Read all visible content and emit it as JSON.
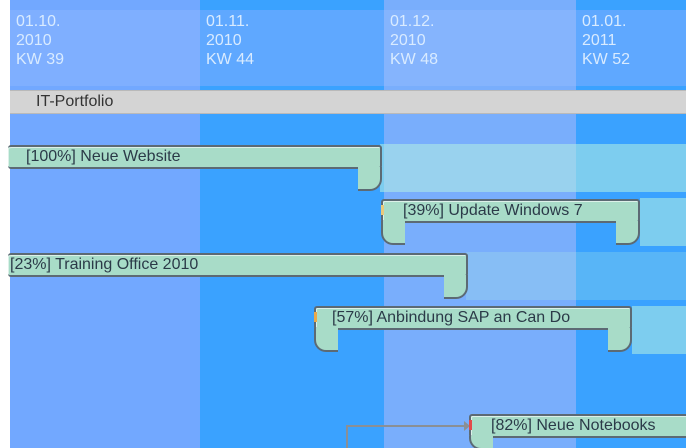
{
  "timeline": {
    "columns": [
      {
        "date": "01.10.",
        "year": "2010",
        "week": "KW 39"
      },
      {
        "date": "01.11.",
        "year": "2010",
        "week": "KW 44"
      },
      {
        "date": "01.12.",
        "year": "2010",
        "week": "KW 48"
      },
      {
        "date": "01.01.",
        "year": "2011",
        "week": "KW 52"
      }
    ]
  },
  "portfolio": {
    "label": "IT-Portfolio"
  },
  "tasks": [
    {
      "label": "[100%] Neue Website",
      "progress": 100
    },
    {
      "label": "[39%] Update Windows 7",
      "progress": 39
    },
    {
      "label": "[23%] Training Office 2010",
      "progress": 23
    },
    {
      "label": "[57%] Anbindung SAP an Can Do",
      "progress": 57
    },
    {
      "label": "[82%] Neue Notebooks",
      "progress": 82
    }
  ],
  "colors": {
    "column_a": "#72a8ff",
    "column_b": "#3aa2ff",
    "task_fill": "#a8dcc8",
    "task_border": "#5c6a74",
    "portfolio_bar": "#d4d4d4"
  }
}
